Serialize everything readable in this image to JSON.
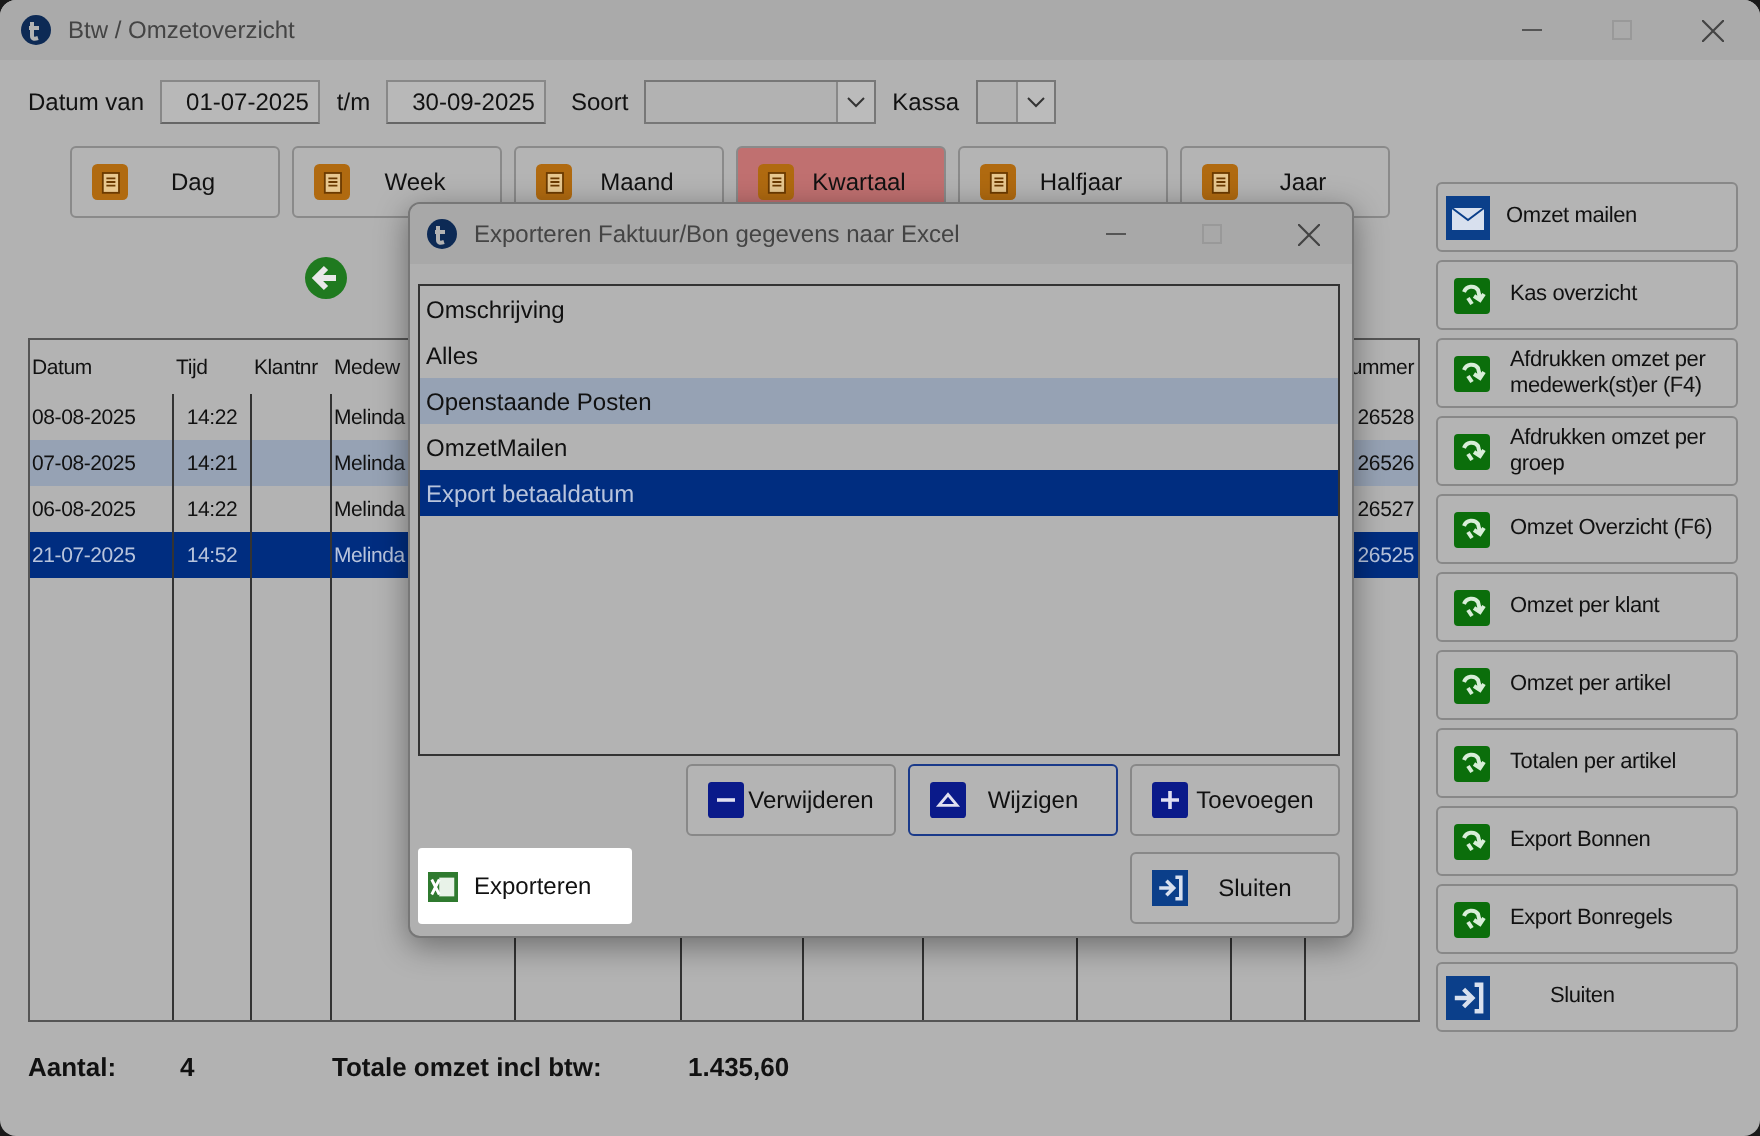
{
  "window": {
    "title": "Btw / Omzetoverzicht"
  },
  "filters": {
    "from_label": "Datum van",
    "from": "01-07-2025",
    "to_label": "t/m",
    "to": "30-09-2025",
    "type_label": "Soort",
    "register_label": "Kassa"
  },
  "periods": [
    {
      "label": "Dag",
      "selected": false
    },
    {
      "label": "Week",
      "selected": false
    },
    {
      "label": "Maand",
      "selected": false
    },
    {
      "label": "Kwartaal",
      "selected": true
    },
    {
      "label": "Halfjaar",
      "selected": false
    },
    {
      "label": "Jaar",
      "selected": false
    }
  ],
  "table": {
    "columns": [
      {
        "header": "Datum"
      },
      {
        "header": "Tijd"
      },
      {
        "header": "Klantnr"
      },
      {
        "header": "Medew"
      },
      {
        "header": "ummer"
      }
    ],
    "rows": [
      {
        "cells": [
          "08-08-2025",
          "14:22",
          "",
          "Melinda",
          "26528"
        ],
        "highlighted": false,
        "selected": false
      },
      {
        "cells": [
          "07-08-2025",
          "14:21",
          "",
          "Melinda",
          "26526"
        ],
        "highlighted": true,
        "selected": false
      },
      {
        "cells": [
          "06-08-2025",
          "14:22",
          "",
          "Melinda",
          "26527"
        ],
        "highlighted": false,
        "selected": false
      },
      {
        "cells": [
          "21-07-2025",
          "14:52",
          "",
          "Melinda",
          "26525"
        ],
        "selected": true
      }
    ]
  },
  "actions": [
    {
      "label": "Omzet mailen",
      "kind": "mail"
    },
    {
      "label": "Kas overzicht",
      "kind": "report"
    },
    {
      "label": "Afdrukken omzet per medewerk(st)er (F4)",
      "kind": "report"
    },
    {
      "label": "Afdrukken omzet per groep",
      "kind": "report"
    },
    {
      "label": "Omzet Overzicht (F6)",
      "kind": "report"
    },
    {
      "label": "Omzet per klant",
      "kind": "report"
    },
    {
      "label": "Omzet per artikel",
      "kind": "report"
    },
    {
      "label": "Totalen per artikel",
      "kind": "report"
    },
    {
      "label": "Export Bonnen",
      "kind": "report"
    },
    {
      "label": "Export Bonregels",
      "kind": "report"
    },
    {
      "label": "Sluiten",
      "kind": "exit"
    }
  ],
  "summary": {
    "count_label": "Aantal:",
    "count": "4",
    "total_label": "Totale omzet incl btw:",
    "total": "1.435,60"
  },
  "dialog": {
    "title": "Exporteren Faktuur/Bon gegevens naar Excel",
    "list_header": "Omschrijving",
    "items": [
      {
        "label": "Alles",
        "highlighted": false,
        "selected": false
      },
      {
        "label": "Openstaande Posten",
        "highlighted": true,
        "selected": false
      },
      {
        "label": "OmzetMailen",
        "highlighted": false,
        "selected": false
      },
      {
        "label": "Export betaaldatum",
        "selected": true
      }
    ],
    "buttons": [
      {
        "label": "Verwijderen",
        "kind": "remove",
        "focused": false
      },
      {
        "label": "Wijzigen",
        "kind": "edit",
        "focused": true
      },
      {
        "label": "Toevoegen",
        "kind": "add",
        "focused": false
      }
    ],
    "export_button": "Exporteren",
    "close_button": "Sluiten"
  }
}
